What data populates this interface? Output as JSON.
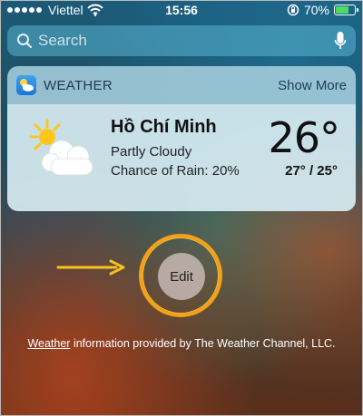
{
  "status_bar": {
    "carrier": "Viettel",
    "time": "15:56",
    "battery_percent": "70%",
    "battery_level": 0.7,
    "icons": [
      "signal-icon",
      "wifi-icon",
      "orientation-lock-icon",
      "battery-icon"
    ]
  },
  "search": {
    "placeholder": "Search",
    "icons": [
      "search-icon",
      "microphone-icon"
    ]
  },
  "widget": {
    "title": "WEATHER",
    "show_more": "Show More",
    "city": "Hồ Chí Minh",
    "condition": "Partly Cloudy",
    "rain": "Chance of Rain: 20%",
    "temperature": "26°",
    "range": "27° / 25°",
    "icon": "partly-cloudy-icon"
  },
  "edit": {
    "label": "Edit",
    "highlight_color": "#f6a019"
  },
  "footer": {
    "link": "Weather",
    "text": " information provided by The Weather Channel, LLC."
  },
  "colors": {
    "battery": "#4cd964",
    "accent_orange": "#f6a019"
  }
}
